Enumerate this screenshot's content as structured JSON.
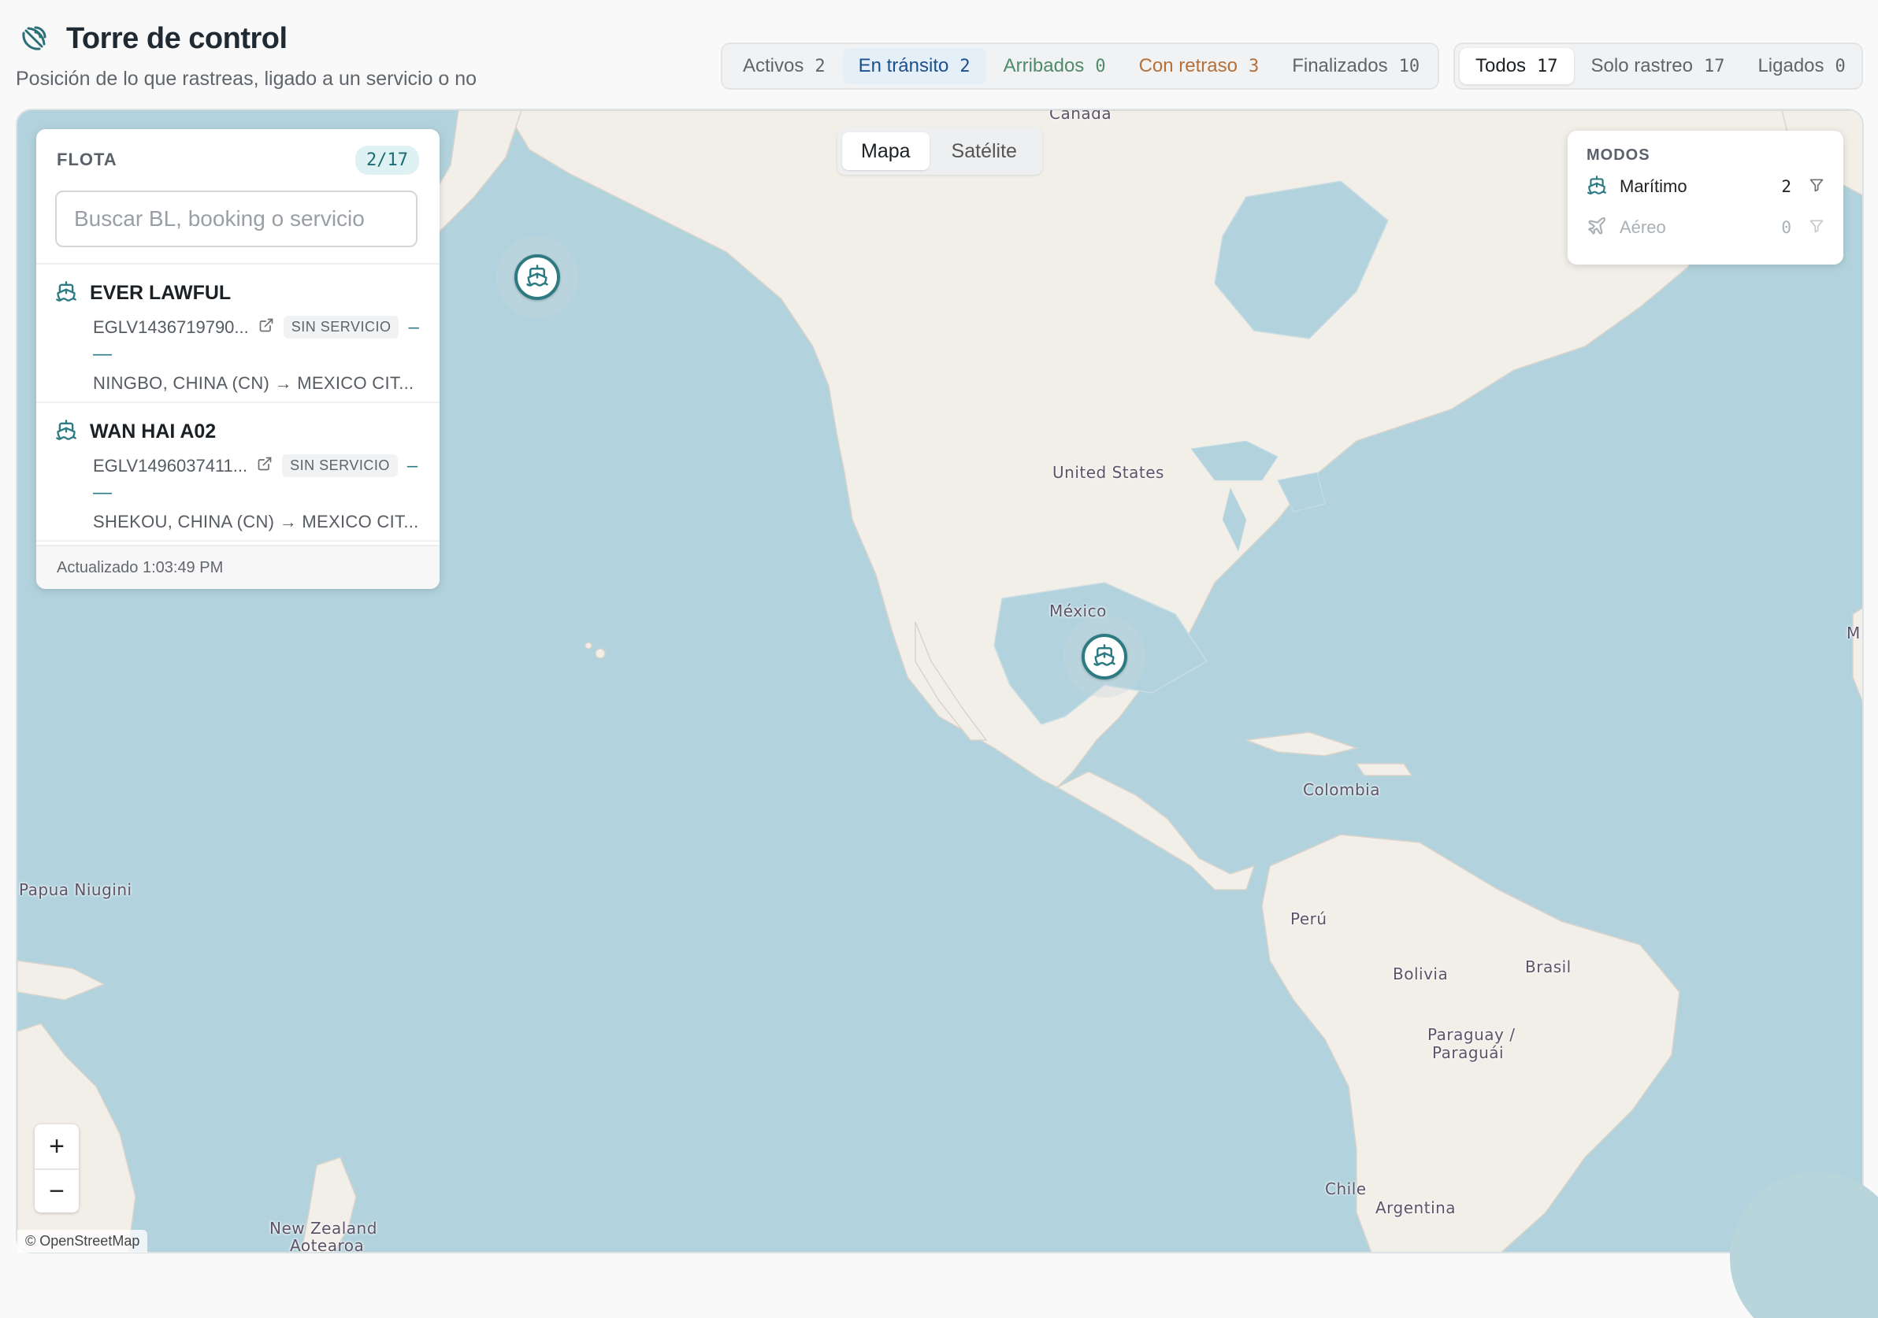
{
  "header": {
    "title": "Torre de control",
    "subtitle": "Posición de lo que rastreas, ligado a un servicio o no"
  },
  "status_filters": [
    {
      "label": "Activos",
      "count": "2",
      "color": "#5f656b",
      "active": false
    },
    {
      "label": "En tránsito",
      "count": "2",
      "color": "#1d4f8c",
      "active": true
    },
    {
      "label": "Arribados",
      "count": "0",
      "color": "#4f8a6a",
      "active": false
    },
    {
      "label": "Con retraso",
      "count": "3",
      "color": "#b5703a",
      "active": false
    },
    {
      "label": "Finalizados",
      "count": "10",
      "color": "#5f656b",
      "active": false
    }
  ],
  "scope_filters": [
    {
      "label": "Todos",
      "count": "17",
      "active": true
    },
    {
      "label": "Solo rastreo",
      "count": "17",
      "active": false
    },
    {
      "label": "Ligados",
      "count": "0",
      "active": false
    }
  ],
  "map_toggle": {
    "map": "Mapa",
    "satellite": "Satélite",
    "selected": "Mapa"
  },
  "fleet": {
    "title": "FLOTA",
    "badge": "2/17",
    "search_placeholder": "Buscar BL, booking o servicio",
    "vessels": [
      {
        "name": "EVER LAWFUL",
        "bl": "EGLV1436719790...",
        "tag": "SIN SERVICIO",
        "dash": "–",
        "dash2": "—",
        "route": "NINGBO, CHINA (CN) → MEXICO CIT..."
      },
      {
        "name": "WAN HAI A02",
        "bl": "EGLV1496037411...",
        "tag": "SIN SERVICIO",
        "dash": "–",
        "dash2": "—",
        "route": "SHEKOU, CHINA (CN) → MEXICO CIT..."
      }
    ],
    "updated": "Actualizado 1:03:49 PM"
  },
  "modes": {
    "title": "MODOS",
    "items": [
      {
        "label": "Marítimo",
        "count": "2",
        "icon": "ship-icon"
      },
      {
        "label": "Aéreo",
        "count": "0",
        "icon": "plane-icon"
      }
    ]
  },
  "map_labels": {
    "canada": "Canada",
    "us": "United States",
    "mexico": "México",
    "colombia": "Colombia",
    "peru": "Perú",
    "bolivia": "Bolivia",
    "brasil": "Brasil",
    "paraguay1": "Paraguay /",
    "paraguay2": "Paraguái",
    "chile": "Chile",
    "argentina": "Argentina",
    "png": "Papua Niugini",
    "nz1": "New Zealand",
    "nz2": "Aotearoa",
    "edge": "M."
  },
  "zoom": {
    "in": "+",
    "out": "−"
  },
  "attribution": "© OpenStreetMap",
  "colors": {
    "accent": "#2c7b82",
    "water": "#b2d3dd",
    "land": "#f2efe9"
  }
}
